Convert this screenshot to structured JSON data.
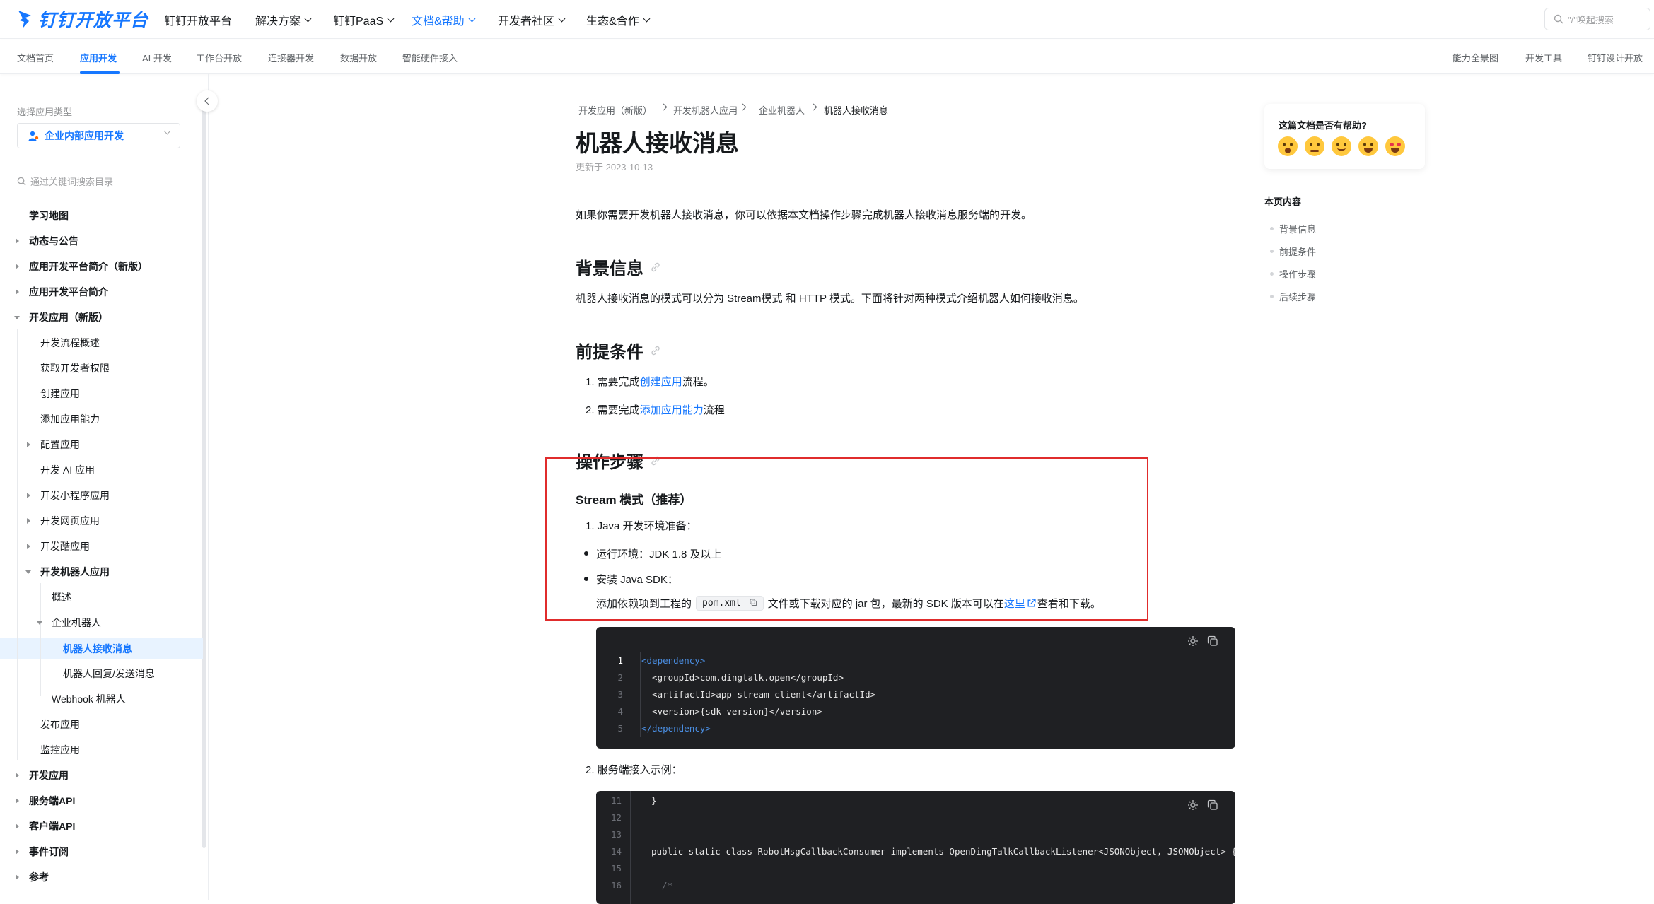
{
  "topnav": {
    "logo_text": "钉钉开放平台",
    "items": [
      {
        "label": "钉钉开放平台",
        "dropdown": false,
        "active": false
      },
      {
        "label": "解决方案",
        "dropdown": true,
        "active": false
      },
      {
        "label": "钉钉PaaS",
        "dropdown": true,
        "active": false
      },
      {
        "label": "文档&帮助",
        "dropdown": true,
        "active": true
      },
      {
        "label": "开发者社区",
        "dropdown": true,
        "active": false
      },
      {
        "label": "生态&合作",
        "dropdown": true,
        "active": false
      }
    ],
    "search_placeholder": "\"/\"唤起搜索"
  },
  "subnav": {
    "left": [
      "文档首页",
      "应用开发",
      "AI 开发",
      "工作台开放",
      "连接器开发",
      "数据开放",
      "智能硬件接入"
    ],
    "active": "应用开发",
    "right": [
      "能力全景图",
      "开发工具",
      "钉钉设计开放"
    ]
  },
  "sidebar": {
    "app_type_label": "选择应用类型",
    "app_type_value": "企业内部应用开发",
    "search_placeholder": "通过关键词搜索目录",
    "items": [
      {
        "label": "学习地图"
      },
      {
        "label": "动态与公告"
      },
      {
        "label": "应用开发平台简介（新版）"
      },
      {
        "label": "应用开发平台简介"
      },
      {
        "label": "开发应用（新版）"
      },
      {
        "label": "开发流程概述"
      },
      {
        "label": "获取开发者权限"
      },
      {
        "label": "创建应用"
      },
      {
        "label": "添加应用能力"
      },
      {
        "label": "配置应用"
      },
      {
        "label": "开发 AI 应用"
      },
      {
        "label": "开发小程序应用"
      },
      {
        "label": "开发网页应用"
      },
      {
        "label": "开发酷应用"
      },
      {
        "label": "开发机器人应用"
      },
      {
        "label": "概述"
      },
      {
        "label": "企业机器人"
      },
      {
        "label": "机器人接收消息"
      },
      {
        "label": "机器人回复/发送消息"
      },
      {
        "label": "Webhook 机器人"
      },
      {
        "label": "发布应用"
      },
      {
        "label": "监控应用"
      },
      {
        "label": "开发应用"
      },
      {
        "label": "服务端API"
      },
      {
        "label": "客户端API"
      },
      {
        "label": "事件订阅"
      },
      {
        "label": "参考"
      }
    ]
  },
  "breadcrumb": [
    "开发应用（新版）",
    "开发机器人应用",
    "企业机器人",
    "机器人接收消息"
  ],
  "article": {
    "title": "机器人接收消息",
    "updated": "更新于 2023-10-13",
    "intro": "如果你需要开发机器人接收消息，你可以依据本文档操作步骤完成机器人接收消息服务端的开发。",
    "bg_heading": "背景信息",
    "bg_text": "机器人接收消息的模式可以分为 Stream模式 和 HTTP 模式。下面将针对两种模式介绍机器人如何接收消息。",
    "pre_heading": "前提条件",
    "pre_1_prefix": "1. 需要完成",
    "pre_1_link": "创建应用",
    "pre_1_suffix": "流程。",
    "pre_2_prefix": "2. 需要完成",
    "pre_2_link": "添加应用能力",
    "pre_2_suffix": "流程",
    "steps_heading": "操作步骤",
    "stream_heading": "Stream 模式（推荐）",
    "step_1": "1. Java 开发环境准备：",
    "bullet_1": "运行环境：JDK 1.8 及以上",
    "bullet_2": "安装 Java SDK：",
    "sdk_prefix": "添加依赖项到工程的",
    "sdk_code": "pom.xml",
    "sdk_middle": "文件或下载对应的 jar 包，最新的 SDK 版本可以在",
    "sdk_link": "这里",
    "sdk_suffix": "查看和下载。",
    "step_2": "2. 服务端接入示例："
  },
  "code1": {
    "lines": [
      {
        "n": "1",
        "text": "<dependency>"
      },
      {
        "n": "2",
        "text": "  <groupId>com.dingtalk.open</groupId>"
      },
      {
        "n": "3",
        "text": "  <artifactId>app-stream-client</artifactId>"
      },
      {
        "n": "4",
        "text": "  <version>{sdk-version}</version>"
      },
      {
        "n": "5",
        "text": "</dependency>"
      }
    ]
  },
  "code2": {
    "lines": [
      {
        "n": "11",
        "text": "}"
      },
      {
        "n": "12",
        "text": ""
      },
      {
        "n": "13",
        "text": ""
      },
      {
        "n": "14",
        "text": "public static class RobotMsgCallbackConsumer implements OpenDingTalkCallbackListener<JSONObject, JSONObject> {"
      },
      {
        "n": "15",
        "text": ""
      },
      {
        "n": "16",
        "text": "  /*"
      }
    ]
  },
  "feedback": {
    "question": "这篇文档是否有帮助?"
  },
  "toc": {
    "title": "本页内容",
    "items": [
      "背景信息",
      "前提条件",
      "操作步骤",
      "后续步骤"
    ]
  },
  "colors": {
    "brand": "#1677ff",
    "highlight": "#e02c2c",
    "code_bg": "#1f2023"
  }
}
